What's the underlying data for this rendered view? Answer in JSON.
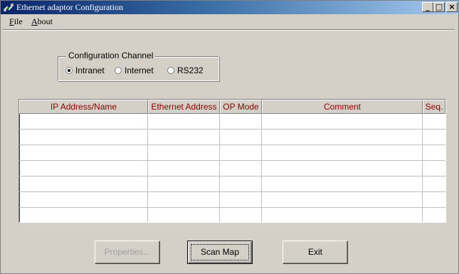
{
  "window": {
    "title": "Ethernet adaptor Configuration",
    "controls": {
      "minimize": "_",
      "maximize": "□",
      "close": "×"
    }
  },
  "menu": {
    "items": [
      {
        "mnemonic": "F",
        "rest": "ile"
      },
      {
        "mnemonic": "A",
        "rest": "bout"
      }
    ]
  },
  "config_channel": {
    "legend": "Configuration Channel",
    "options": [
      {
        "label": "Intranet",
        "selected": true
      },
      {
        "label": "Internet",
        "selected": false
      },
      {
        "label": "RS232",
        "selected": false
      }
    ]
  },
  "table": {
    "columns": [
      "IP Address/Name",
      "Ethernet Address",
      "OP Mode",
      "Comment",
      "Seq."
    ],
    "header_color": "#8b0000",
    "rows": []
  },
  "buttons": {
    "properties": "Properties...",
    "scan_map": "Scan Map",
    "exit": "Exit"
  }
}
